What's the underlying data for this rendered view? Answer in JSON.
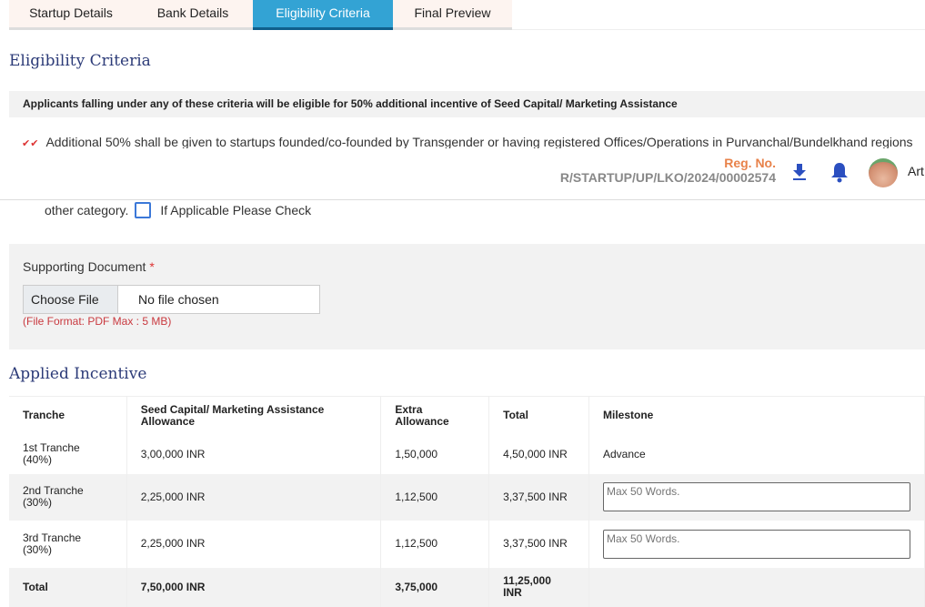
{
  "tabs": [
    {
      "label": "Startup Details",
      "active": false
    },
    {
      "label": "Bank Details",
      "active": false
    },
    {
      "label": "Eligibility Criteria",
      "active": true
    },
    {
      "label": "Final Preview",
      "active": false
    }
  ],
  "eligibility": {
    "title": "Eligibility Criteria",
    "note": "Applicants falling under any of these criteria will be eligible for 50% additional incentive of Seed Capital/ Marketing Assistance",
    "criterion": "Additional 50% shall be given to startups founded/co-founded by Transgender or having registered Offices/Operations in Purvanchal/Bundelkhand regions",
    "other_text": "other category.",
    "checkbox_label": "If Applicable Please Check",
    "checked": false
  },
  "header": {
    "reg_label": "Reg. No.",
    "reg_value": "R/STARTUP/UP/LKO/2024/00002574",
    "user_name": "Art",
    "download_icon": "download-icon",
    "bell_icon": "bell-icon",
    "accent": "#2b4fc0"
  },
  "document": {
    "label": "Supporting Document",
    "required": "*",
    "choose_label": "Choose File",
    "file_status": "No file chosen",
    "hint": "(File Format: PDF Max : 5 MB)"
  },
  "incentive": {
    "title": "Applied Incentive",
    "columns": [
      "Tranche",
      "Seed Capital/ Marketing Assistance Allowance",
      "Extra Allowance",
      "Total",
      "Milestone"
    ],
    "rows": [
      {
        "tranche": "1st Tranche",
        "pct": "(40%)",
        "seed": "3,00,000 INR",
        "extra": "1,50,000",
        "total": "4,50,000 INR",
        "milestone": "Advance"
      },
      {
        "tranche": "2nd Tranche",
        "pct": "(30%)",
        "seed": "2,25,000 INR",
        "extra": "1,12,500",
        "total": "3,37,500 INR",
        "placeholder": "Max 50 Words."
      },
      {
        "tranche": "3rd Tranche",
        "pct": "(30%)",
        "seed": "2,25,000 INR",
        "extra": "1,12,500",
        "total": "3,37,500 INR",
        "placeholder": "Max 50 Words."
      }
    ],
    "total": {
      "label": "Total",
      "seed": "7,50,000 INR",
      "extra": "3,75,000",
      "total": "11,25,000 INR"
    }
  }
}
